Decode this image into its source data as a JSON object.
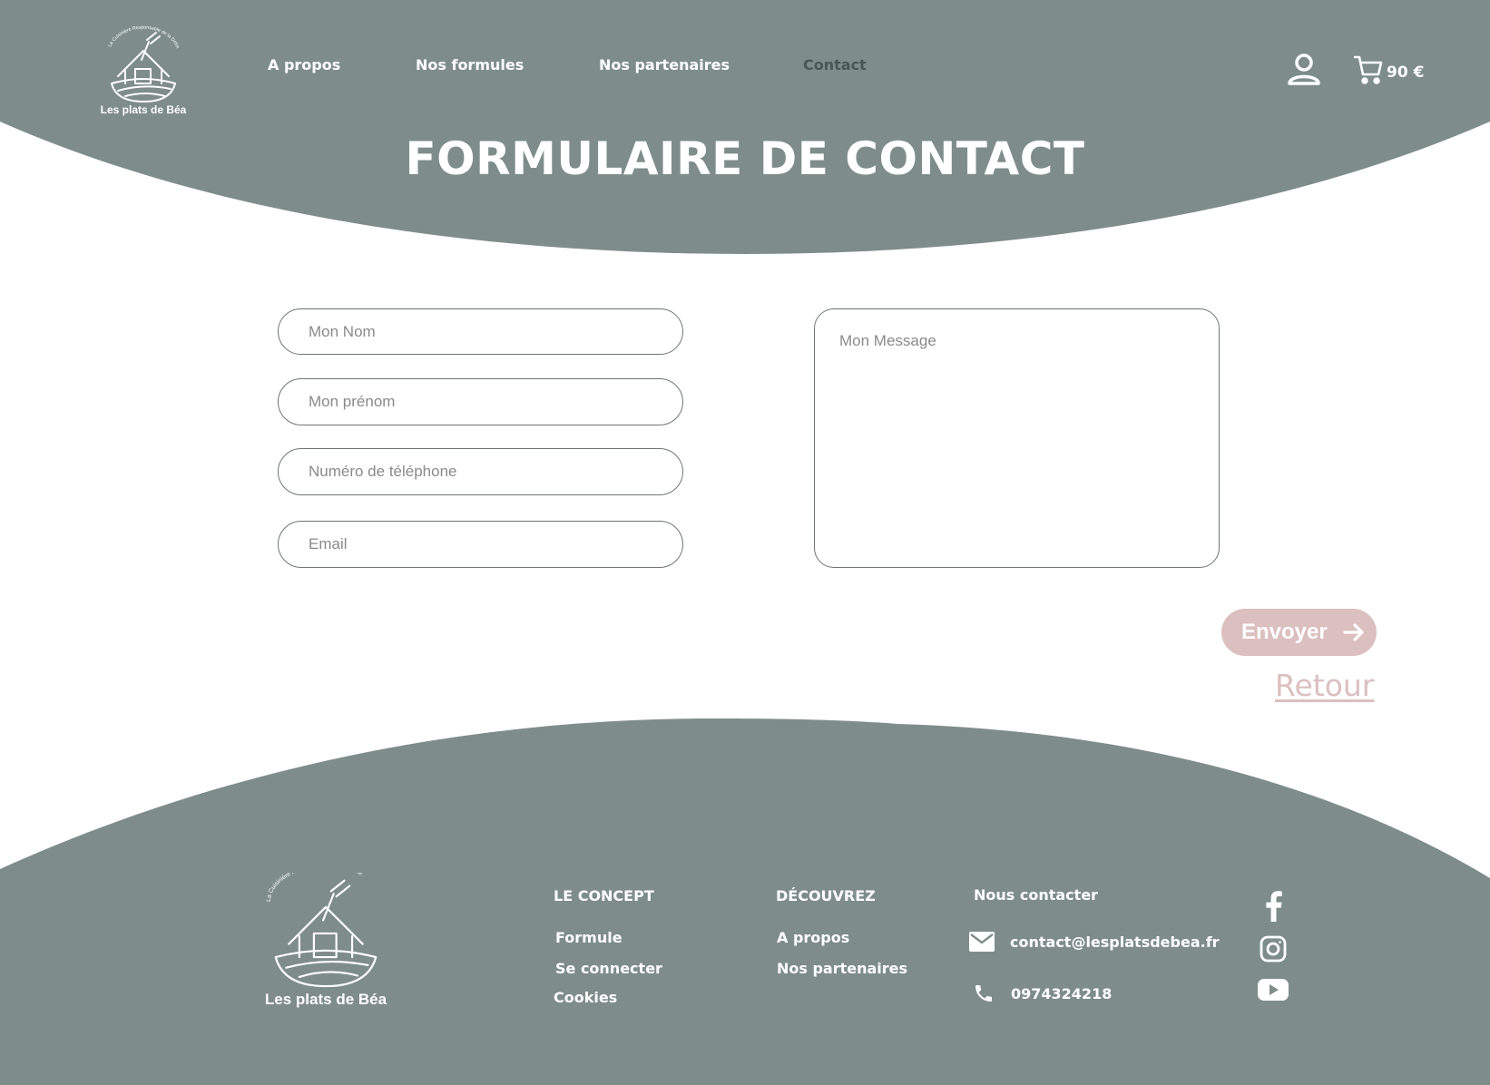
{
  "brand": {
    "name": "Les plats de Béa",
    "tagline": "La Cuisinière Responsable de la Drôme"
  },
  "colors": {
    "primary": "#7f8d8a",
    "accent": "#dcbfbf",
    "active_nav": "#4a5653",
    "background": "#ffffff"
  },
  "nav": {
    "items": [
      {
        "label": "A propos",
        "active": false
      },
      {
        "label": "Nos formules",
        "active": false
      },
      {
        "label": "Nos partenaires",
        "active": false
      },
      {
        "label": "Contact",
        "active": true
      }
    ]
  },
  "header": {
    "user_icon": "user-icon",
    "cart_icon": "cart-icon",
    "cart_total": "90 €"
  },
  "page": {
    "title": "FORMULAIRE DE CONTACT"
  },
  "form": {
    "nom_placeholder": "Mon Nom",
    "prenom_placeholder": "Mon prénom",
    "tel_placeholder": "Numéro de téléphone",
    "email_placeholder": "Email",
    "message_placeholder": "Mon Message",
    "submit_label": "Envoyer",
    "submit_icon": "arrow-right-icon",
    "back_label": "Retour"
  },
  "footer": {
    "concept": {
      "heading": "LE CONCEPT",
      "links": [
        "Formule",
        "Se connecter",
        "Cookies"
      ]
    },
    "discover": {
      "heading": "DÉCOUVREZ",
      "links": [
        "A propos",
        "Nos partenaires"
      ]
    },
    "contact": {
      "heading": "Nous contacter",
      "email": "contact@lesplatsdebea.fr",
      "phone": "0974324218"
    },
    "social": [
      "facebook-icon",
      "instagram-icon",
      "youtube-icon"
    ]
  }
}
